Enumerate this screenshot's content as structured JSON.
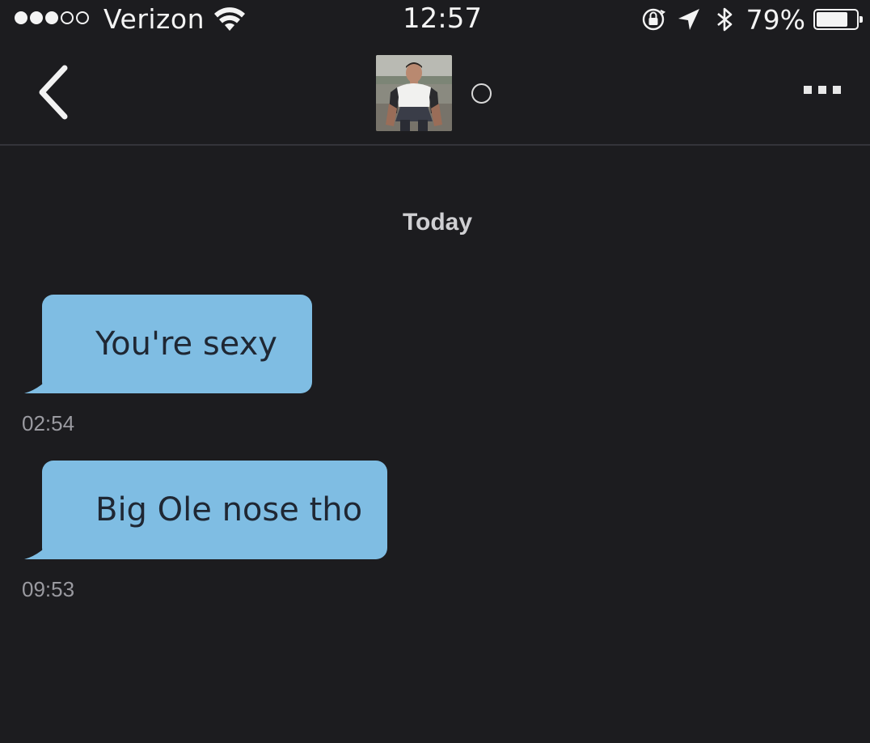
{
  "status_bar": {
    "carrier": "Verizon",
    "time": "12:57",
    "battery_percent": "79%",
    "battery_level": 0.79,
    "signal_bars_filled": 3,
    "signal_bars_total": 5,
    "icons": [
      "wifi-icon",
      "orientation-lock-icon",
      "location-arrow-icon",
      "bluetooth-icon",
      "battery-icon"
    ]
  },
  "header": {
    "back_icon": "chevron-left-icon",
    "avatar_icon": "profile-photo",
    "status_icon": "online-status-ring-icon",
    "more_icon": "ellipsis-icon"
  },
  "chat": {
    "day_label": "Today",
    "messages": [
      {
        "text": "You're sexy",
        "time": "02:54"
      },
      {
        "text": "Big Ole nose tho",
        "time": "09:53"
      }
    ]
  },
  "colors": {
    "background": "#1c1c1f",
    "bubble": "#7fbde3",
    "bubble_text": "#1f2733",
    "timestamp": "#9a9aa0"
  }
}
